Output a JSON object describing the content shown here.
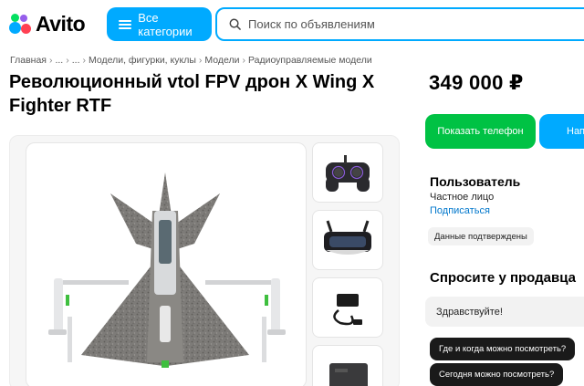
{
  "header": {
    "logo_text": "Avito",
    "categories_label": "Все категории",
    "search_placeholder": "Поиск по объявлениям",
    "accent_color": "#00aaff"
  },
  "breadcrumb": [
    "Главная",
    "...",
    "...",
    "Модели, фигурки, куклы",
    "Модели",
    "Радиоуправляемые модели"
  ],
  "listing": {
    "title": "Революционный vtol FPV дрон X Wing X Fighter RTF",
    "price": "349 000 ₽"
  },
  "actions": {
    "phone_label": "Показать телефон",
    "message_label": "Нап"
  },
  "seller": {
    "name": "Пользователь",
    "type": "Частное лицо",
    "subscribe_label": "Подписаться",
    "verified_label": "Данные подтверждены"
  },
  "ask": {
    "title": "Спросите у продавца",
    "greeting": "Здравствуйте!",
    "questions": [
      "Где и когда можно посмотреть?",
      "Сегодня можно посмотреть?"
    ]
  },
  "gallery": {
    "main_image": "vtol-drone-image",
    "thumbnails": [
      "controller-image",
      "fpv-goggles-image",
      "charger-image",
      "battery-image"
    ]
  }
}
